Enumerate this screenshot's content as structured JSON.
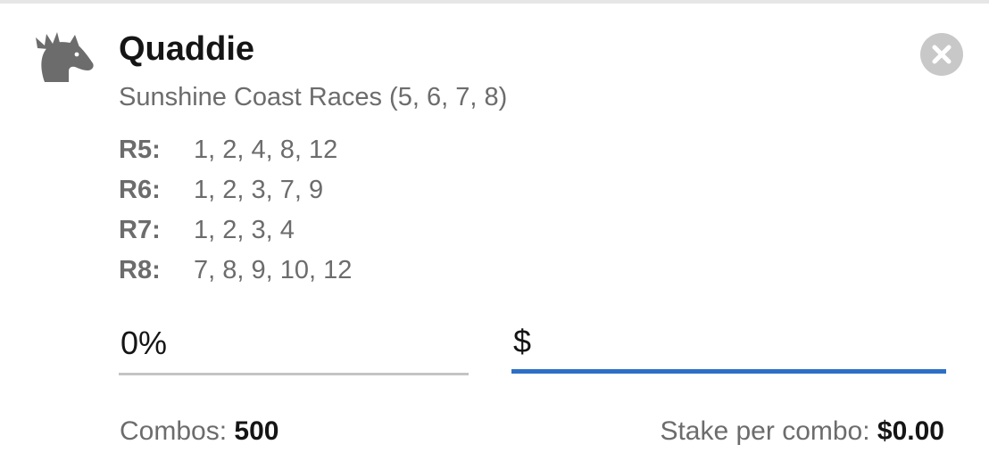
{
  "bet": {
    "title": "Quaddie",
    "meeting": "Sunshine Coast Races (5, 6, 7, 8)",
    "icon": "horse-head-icon",
    "close_icon": "close-circle-icon"
  },
  "legs": [
    {
      "code": "R5:",
      "runners": "1, 2, 4, 8, 12"
    },
    {
      "code": "R6:",
      "runners": "1, 2, 3, 7, 9"
    },
    {
      "code": "R7:",
      "runners": "1, 2, 3, 4"
    },
    {
      "code": "R8:",
      "runners": "7, 8, 9, 10, 12"
    }
  ],
  "inputs": {
    "percentage_value": "0%",
    "stake_prefix": "$",
    "stake_value": ""
  },
  "summary": {
    "combos_label": "Combos:",
    "combos_value": "500",
    "stake_per_combo_label": "Stake per combo:",
    "stake_per_combo_value": "$0.00"
  },
  "colors": {
    "accent": "#2d6fc6",
    "text_primary": "#151515",
    "text_secondary": "#6c6c6c",
    "close_button": "#c8c8c8"
  }
}
